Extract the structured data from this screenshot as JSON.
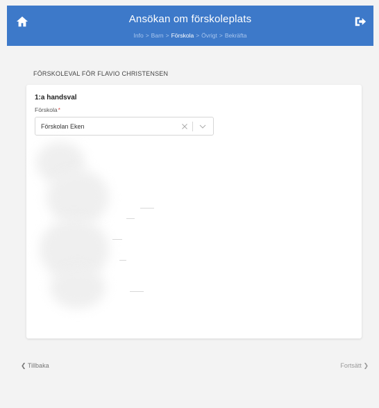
{
  "header": {
    "title": "Ansökan om förskoleplats",
    "home_icon": "home-icon",
    "logout_icon": "logout-icon",
    "steps": [
      "Info",
      "Barn",
      "Förskola",
      "Övrigt",
      "Bekräfta"
    ],
    "active_step": "Förskola",
    "separator": ">"
  },
  "section": {
    "title": "FÖRSKOLEVAL FÖR FLAVIO CHRISTENSEN"
  },
  "choice": {
    "heading": "1:a handsval",
    "field_label": "Förskola",
    "required_mark": "*",
    "selected_value": "Förskolan Eken"
  },
  "footer": {
    "back_label": "Tillbaka",
    "next_label": "Fortsätt"
  },
  "colors": {
    "header_bg": "#3d79c9",
    "page_bg": "#f3f3f3",
    "required": "#d9534f"
  }
}
